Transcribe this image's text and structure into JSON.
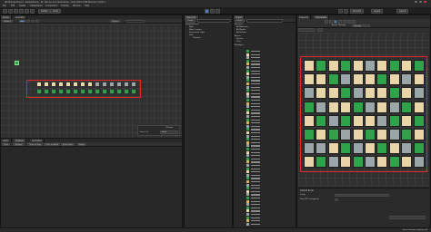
{
  "window": {
    "title": "2D-Tilemap-Project - SampleScene - PC, Mac & Linux Standalone - Unity 2019.3.0f6 Personal <DX11>"
  },
  "menu": [
    "File",
    "Edit",
    "Assets",
    "GameObject",
    "Component",
    "Tilemap",
    "Window",
    "Help"
  ],
  "toolbar": {
    "center_label": "Center",
    "local_label": "Local",
    "account_label": "Account",
    "layers_label": "Layers",
    "layout_label": "Layout"
  },
  "scene_panel": {
    "tabs": [
      "Scene",
      "Animator"
    ],
    "shading_mode": "Shaded",
    "mode_2d": "2D",
    "gizmos_label": "Gizmos",
    "overlay": {
      "title": "Tilemap",
      "focus_label": "Focus On",
      "focus_value": "None"
    }
  },
  "hierarchy": {
    "tab": "Hierarchy",
    "create_label": "Create",
    "items": [
      "SampleScene*",
      "Main",
      "Main Camera",
      "Directional Light",
      "Grid",
      "Tilemap"
    ]
  },
  "project": {
    "tab": "Project",
    "create_label": "Create",
    "tree": [
      "Favorites",
      "All Materials",
      "All Models",
      "All Prefabs",
      "Assets",
      "Scenes",
      "Tiles",
      "Packages"
    ]
  },
  "tile_palette": {
    "tabs": [
      "Inspector",
      "Tile Palette"
    ],
    "active_tilemap_label": "Active Tilemap",
    "active_tilemap_value": "Tilemap",
    "default_brush": "Default Brush",
    "script_label": "Script",
    "flood_fill_label": "Flood Fill Contiguous"
  },
  "console": {
    "tabs": [
      "Game",
      "Console",
      "Animation"
    ],
    "buttons": [
      "Clear",
      "Collapse",
      "Clear on Play",
      "Clear on Build",
      "Error Pause",
      "Editor"
    ]
  },
  "statusbar": {
    "text": "Auto Generate Lighting Off"
  },
  "colors": {
    "accent_blue": "#4b7bc7",
    "selection_red": "#e52727",
    "tile_green": "#2ea34a",
    "tile_sand": "#e8d6a8"
  }
}
